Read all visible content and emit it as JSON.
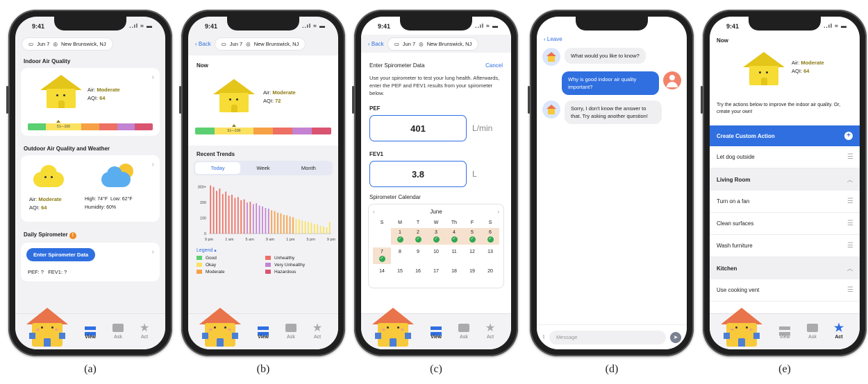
{
  "status": {
    "time": "9:41",
    "signal": "..ıl ≈ ▬"
  },
  "location": {
    "date": "Jun 7",
    "place": "New Brunswick, NJ"
  },
  "nav": {
    "back": "Back",
    "leave": "Leave"
  },
  "tabs": {
    "view": "View",
    "ask": "Ask",
    "act": "Act"
  },
  "scale_label": "51—100",
  "colors": {
    "accent": "#2f6fe0",
    "good": "#5bcf71",
    "okay": "#fbe160",
    "moderate": "#f6a145",
    "unhealthy": "#ee6f63",
    "very_unhealthy": "#c383d2",
    "hazardous": "#d95470"
  },
  "screen_a": {
    "indoor_title": "Indoor Air Quality",
    "air_label": "Air:",
    "air_value": "Moderate",
    "aqi_label": "AQI:",
    "aqi_value": "64",
    "outdoor_title": "Outdoor Air Quality and Weather",
    "out_air_label": "Air:",
    "out_air_value": "Moderate",
    "out_aqi_label": "AQI:",
    "out_aqi_value": "64",
    "high": "High: 74°F",
    "low": "Low: 62°F",
    "humidity": "Humidity: 60%",
    "spiro_title": "Daily Spirometer",
    "spiro_badge": "!",
    "spiro_button": "Enter Spirometer Data",
    "pef": "PEF: ?",
    "fev1": "FEV1: ?"
  },
  "screen_b": {
    "now": "Now",
    "air_label": "Air:",
    "air_value": "Moderate",
    "aqi_label": "AQI:",
    "aqi_value": "72",
    "trends_title": "Recent Trends",
    "trend_tabs": [
      "Today",
      "Week",
      "Month"
    ],
    "legend_title": "Legend ▴",
    "legend": [
      "Good",
      "Unhealthy",
      "Okay",
      "Very Unhealthy",
      "Moderate",
      "Hazardous"
    ]
  },
  "chart_data": {
    "type": "bar",
    "title": "",
    "xlabel": "",
    "ylabel": "",
    "ylim": [
      0,
      330
    ],
    "y_ticks": [
      "300+",
      "200",
      "100",
      "0"
    ],
    "x_ticks": [
      "9 pm",
      "1 am",
      "5 am",
      "9 am",
      "1 pm",
      "5 pm",
      "9 pm"
    ],
    "values": [
      310,
      300,
      275,
      290,
      255,
      270,
      245,
      250,
      230,
      235,
      215,
      220,
      200,
      205,
      190,
      195,
      180,
      175,
      165,
      160,
      150,
      145,
      135,
      130,
      120,
      118,
      110,
      105,
      95,
      92,
      85,
      80,
      75,
      70,
      62,
      58,
      50,
      45,
      40,
      75
    ],
    "grid": false
  },
  "screen_c": {
    "title": "Enter Spirometer Data",
    "cancel": "Cancel",
    "desc": "Use your spirometer to test your lung health. Afterwards, enter the PEF and FEV1 results from your spirometer below.",
    "pef_label": "PEF",
    "pef_value": "401",
    "pef_unit": "L/min",
    "fev1_label": "FEV1",
    "fev1_value": "3.8",
    "fev1_unit": "L",
    "calendar_title": "Spirometer Calendar",
    "month": "June",
    "weekdays": [
      "S",
      "M",
      "T",
      "W",
      "Th",
      "F",
      "S"
    ],
    "days": [
      "",
      "1",
      "2",
      "3",
      "4",
      "5",
      "6",
      "7",
      "8",
      "9",
      "10",
      "11",
      "12",
      "13",
      "14",
      "15",
      "16",
      "17",
      "18",
      "19",
      "20"
    ]
  },
  "screen_d": {
    "q1": "What would you like to know?",
    "q2": "Why is good indoor air quality important?",
    "q3": "Sorry, I don't know the answer to that. Try asking another question!",
    "placeholder": "Message"
  },
  "screen_e": {
    "now": "Now",
    "air_label": "Air:",
    "air_value": "Moderate",
    "aqi_label": "AQI:",
    "aqi_value": "64",
    "desc": "Try the actions below to improve the indoor air quality. Or, create your own!",
    "create": "Create Custom Action",
    "item1": "Let dog outside",
    "room1": "Living Room",
    "item2": "Turn on a fan",
    "item3": "Clean surfaces",
    "item4": "Wash furniture",
    "room2": "Kitchen",
    "item5": "Use cooking vent"
  },
  "labels": [
    "(a)",
    "(b)",
    "(c)",
    "(d)",
    "(e)"
  ]
}
